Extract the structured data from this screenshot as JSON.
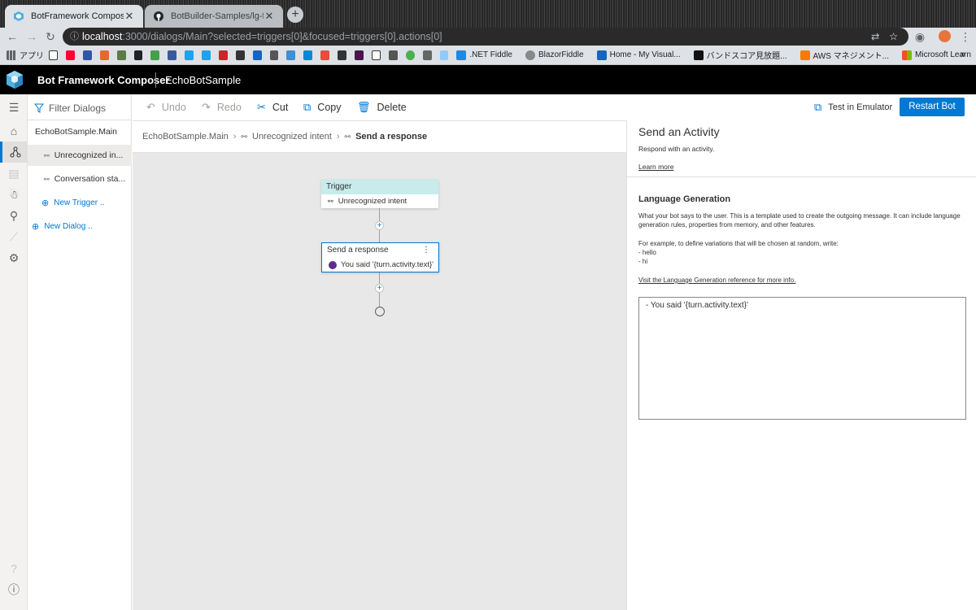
{
  "browser": {
    "tabs": [
      {
        "title": "BotFramework Composer",
        "active": true
      },
      {
        "title": "BotBuilder-Samples/lg-file-form",
        "active": false
      }
    ],
    "url_host": "localhost",
    "url_rest": ":3000/dialogs/Main?selected=triggers[0]&focused=triggers[0].actions[0]",
    "bookmarks": [
      {
        "label": "アプリ"
      },
      {
        "label": ".NET Fiddle",
        "color": "#1e88e5"
      },
      {
        "label": "BlazorFiddle",
        "color": "#888888"
      },
      {
        "label": "Home - My Visual...",
        "color": "#1565c0"
      },
      {
        "label": "バンドスコア見放題...",
        "color": "#111111"
      },
      {
        "label": "AWS マネジメント...",
        "color": "#f57c00"
      },
      {
        "label": "Microsoft Learn",
        "color": "#d32f2f"
      }
    ],
    "more": "»"
  },
  "app": {
    "title": "Bot Framework Composer",
    "project": "EchoBotSample",
    "accent": "#0078d4"
  },
  "tree": {
    "filter_placeholder": "Filter Dialogs",
    "root": "EchoBotSample.Main",
    "items": [
      {
        "label": "Unrecognized in...",
        "selected": true
      },
      {
        "label": "Conversation sta...",
        "selected": false
      }
    ],
    "new_trigger": "New Trigger ..",
    "new_dialog": "New Dialog .."
  },
  "commands": {
    "undo": "Undo",
    "redo": "Redo",
    "cut": "Cut",
    "copy": "Copy",
    "delete": "Delete",
    "test": "Test in Emulator",
    "restart": "Restart Bot"
  },
  "breadcrumb": {
    "items": [
      "EchoBotSample.Main",
      "Unrecognized intent",
      "Send a response"
    ]
  },
  "canvas": {
    "trigger": {
      "header": "Trigger",
      "body": "Unrecognized intent"
    },
    "action": {
      "header": "Send a response",
      "body": "You said '{turn.activity.text}'"
    }
  },
  "props": {
    "title": "Send an Activity",
    "desc": "Respond with an activity.",
    "learn_more": "Learn more",
    "section": "Language Generation",
    "para1": "What your bot says to the user. This is a template used to create the outgoing message. It can include language generation rules, properties from memory, and other features.",
    "para2": "For example, to define variations that will be chosen at random, write:",
    "ex1": "- hello",
    "ex2": "- hi",
    "ref_link": "Visit the Language Generation reference for more info.",
    "lg_value": "- You said '{turn.activity.text}'"
  }
}
